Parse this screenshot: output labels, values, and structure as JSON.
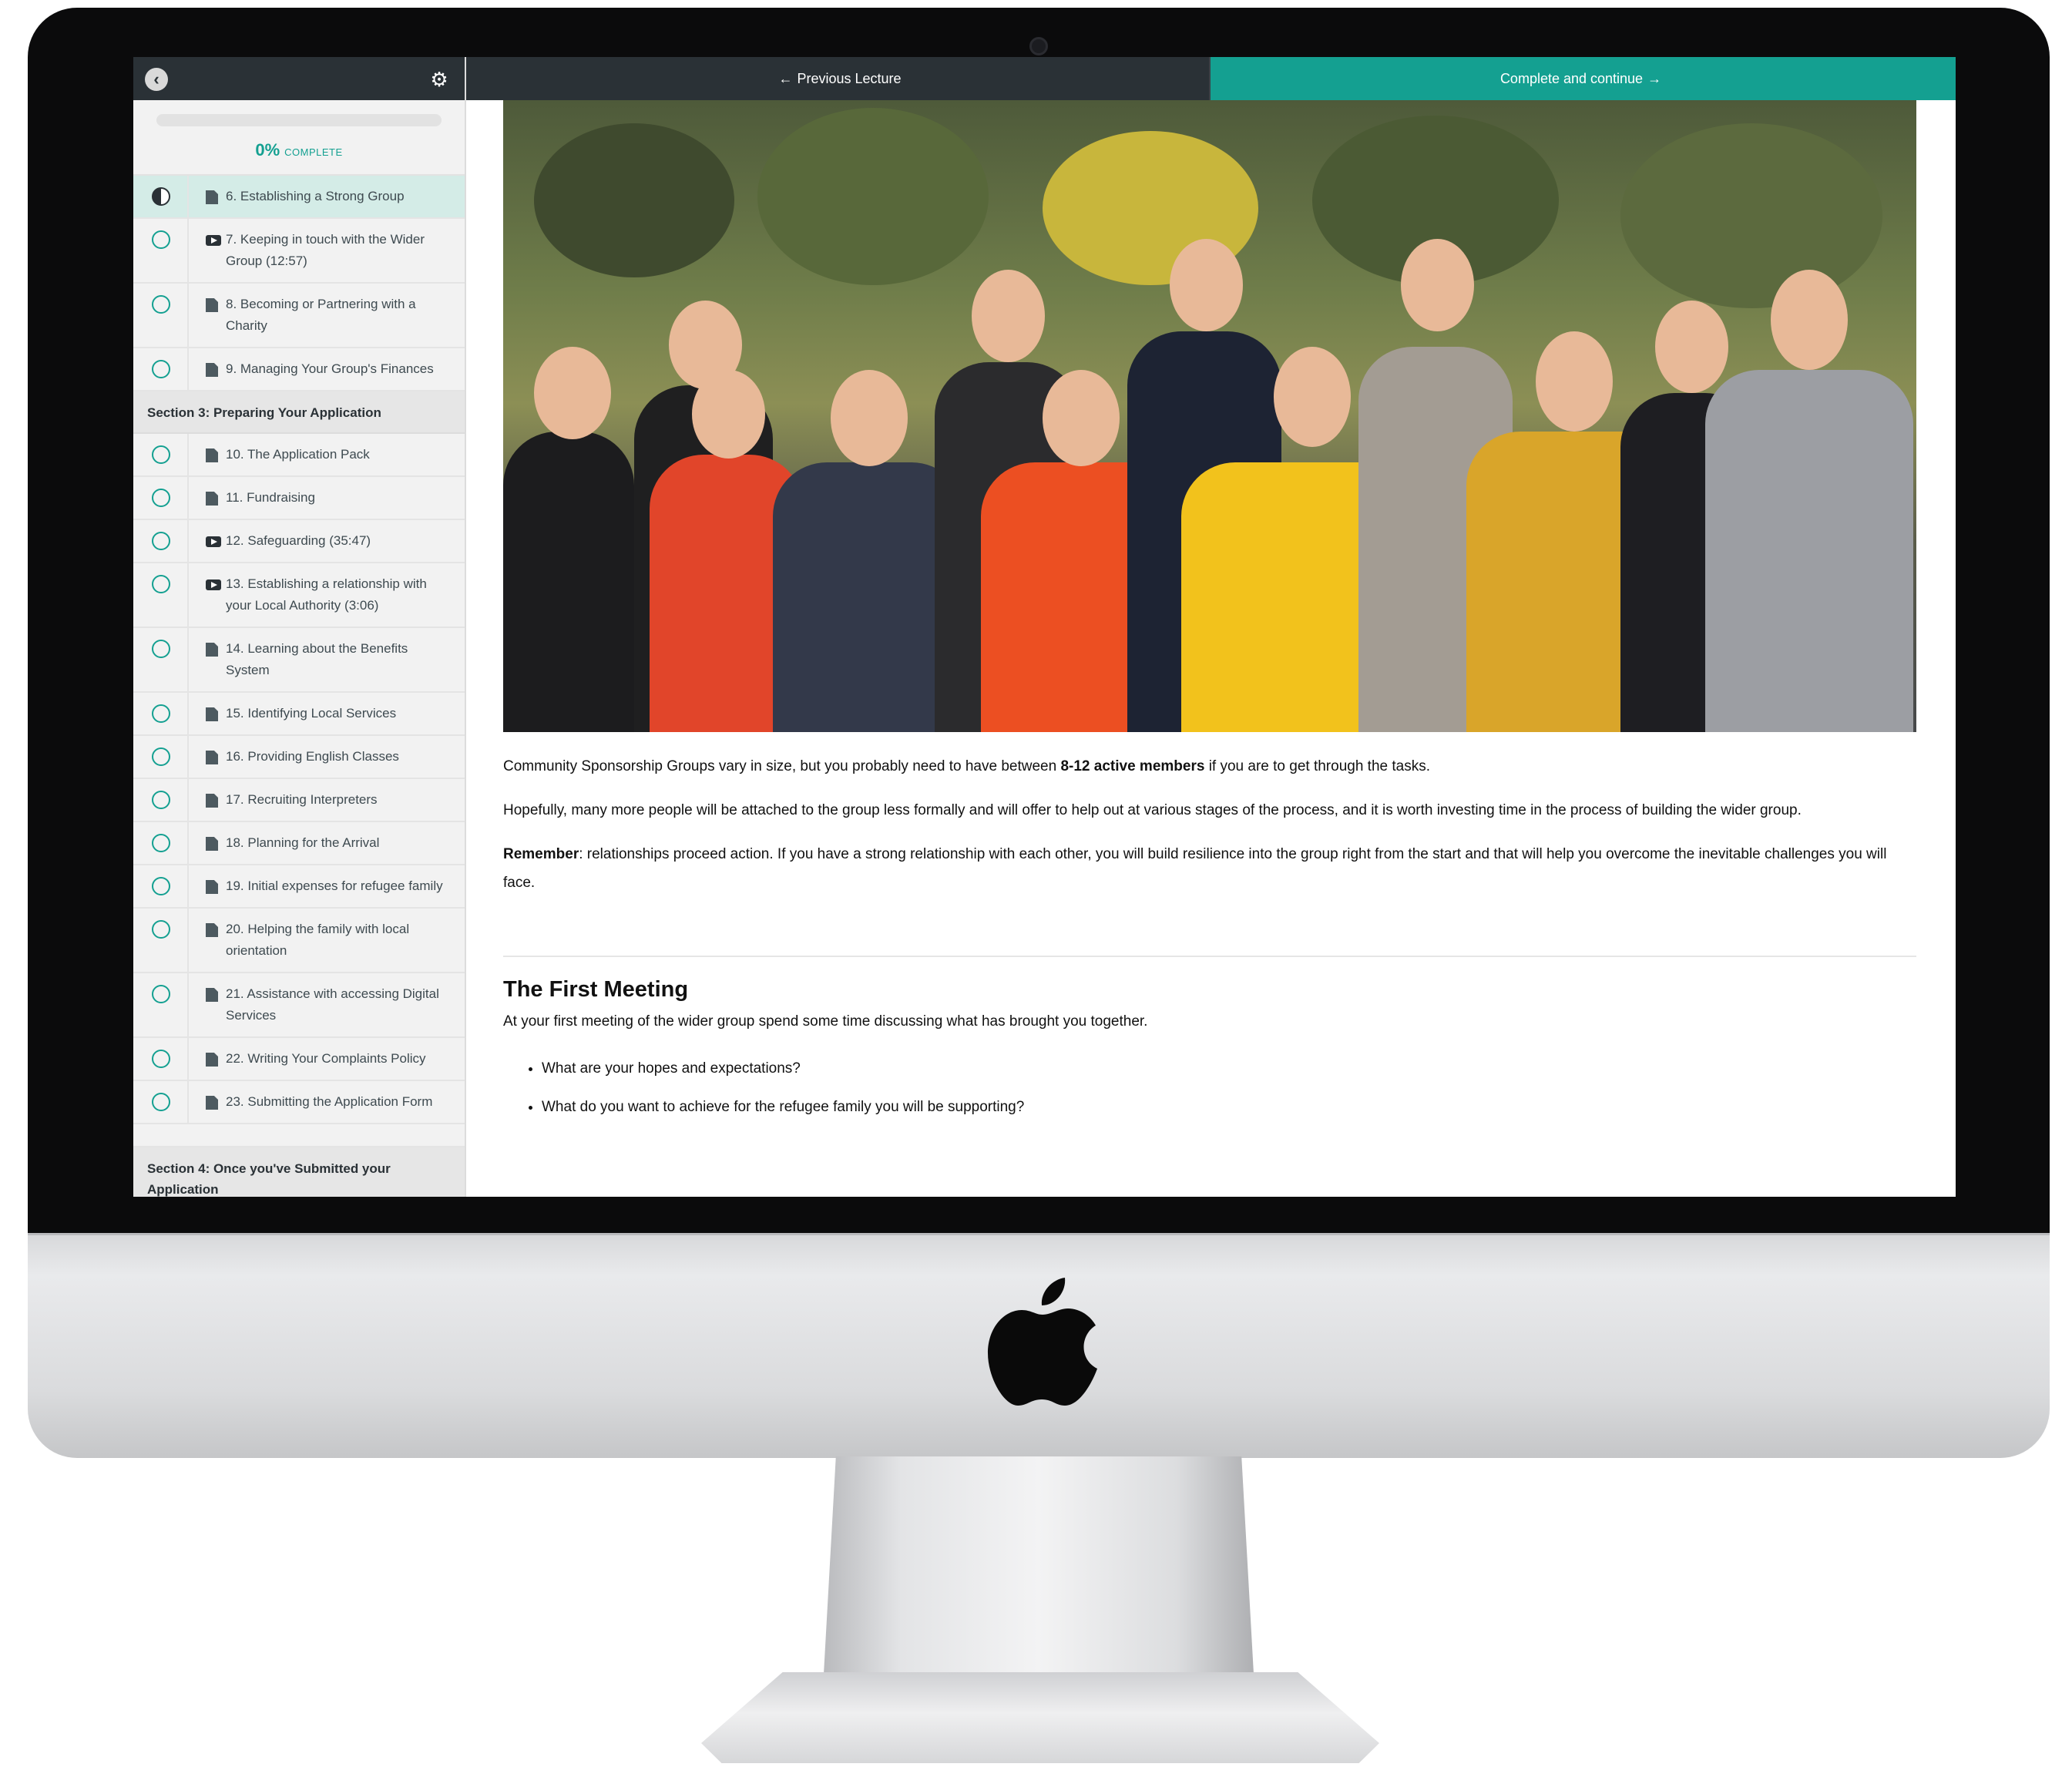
{
  "sidebar": {
    "progress_percent": "0%",
    "progress_label": "COMPLETE",
    "items_a": [
      {
        "label": "6. Establishing a Strong Group",
        "type": "doc",
        "active": true
      },
      {
        "label": "7. Keeping in touch with the Wider Group (12:57)",
        "type": "video"
      },
      {
        "label": "8. Becoming or Partnering with a Charity",
        "type": "doc"
      },
      {
        "label": "9. Managing Your Group's Finances",
        "type": "doc"
      }
    ],
    "section3_title": "Section 3: Preparing Your Application",
    "items_b": [
      {
        "label": "10. The Application Pack",
        "type": "doc"
      },
      {
        "label": "11. Fundraising",
        "type": "doc"
      },
      {
        "label": "12. Safeguarding (35:47)",
        "type": "video"
      },
      {
        "label": "13. Establishing a relationship with your Local Authority (3:06)",
        "type": "video"
      },
      {
        "label": "14. Learning about the Benefits System",
        "type": "doc"
      },
      {
        "label": "15. Identifying Local Services",
        "type": "doc"
      },
      {
        "label": "16. Providing English Classes",
        "type": "doc"
      },
      {
        "label": "17. Recruiting Interpreters",
        "type": "doc"
      },
      {
        "label": "18. Planning for the Arrival",
        "type": "doc"
      },
      {
        "label": "19. Initial expenses for refugee family",
        "type": "doc"
      },
      {
        "label": "20. Helping the family with local orientation",
        "type": "doc"
      },
      {
        "label": "21. Assistance with accessing Digital Services",
        "type": "doc"
      },
      {
        "label": "22. Writing Your Complaints Policy",
        "type": "doc"
      },
      {
        "label": "23. Submitting the Application Form",
        "type": "doc"
      }
    ],
    "section4_title": "Section 4: Once you've Submitted your Application"
  },
  "nav": {
    "prev_label": "Previous Lecture",
    "next_label": "Complete and continue"
  },
  "content": {
    "p1_before": "Community Sponsorship Groups vary in size, but you probably need to have between ",
    "p1_bold": "8-12 active members",
    "p1_after": " if you are to get through the tasks.",
    "p2": "Hopefully, many more people will be attached to the group less formally and will offer to help out at various stages of the process, and it is worth investing time in the process of building the wider group.",
    "p3_bold": "Remember",
    "p3_after": ": relationships proceed action. If you have a strong relationship with each other, you will build resilience into the group right from the start and that will help you overcome the inevitable challenges you will face.",
    "heading": "The First Meeting",
    "intro": "At your first meeting of the wider group spend some time discussing what has brought you together.",
    "questions": [
      "What are your hopes and expectations?",
      "What do you want to achieve for the refugee family you will be supporting?"
    ]
  },
  "colors": {
    "accent": "#14a091",
    "dark": "#2a3136",
    "active_row": "#d4ece7"
  }
}
